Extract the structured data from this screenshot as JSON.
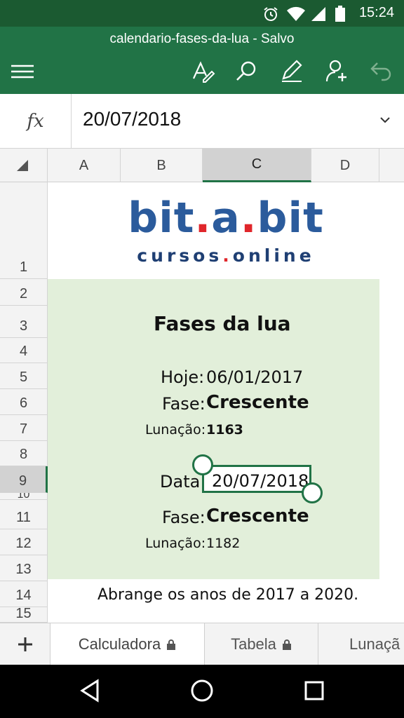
{
  "status_bar": {
    "time": "15:24"
  },
  "app": {
    "doc_title": "calendario-fases-da-lua - Salvo"
  },
  "formula_bar": {
    "fx_label": "fx",
    "value": "20/07/2018"
  },
  "columns": [
    "A",
    "B",
    "C",
    "D"
  ],
  "selected_column": "C",
  "rows": [
    "1",
    "2",
    "3",
    "4",
    "5",
    "6",
    "7",
    "8",
    "9",
    "10",
    "11",
    "12",
    "13",
    "14",
    "15"
  ],
  "selected_row": "9",
  "logo": {
    "line1": "bit.a.bit",
    "line2": "cursos.online"
  },
  "sheet": {
    "heading": "Fases da lua",
    "today_label": "Hoje:",
    "today_value": "06/01/2017",
    "phase_label": "Fase:",
    "phase_value": "Crescente",
    "lunation_label": "Lunação:",
    "lunation_value": "1163",
    "date_label": "Data:",
    "date_value": "20/07/2018",
    "phase2_label": "Fase:",
    "phase2_value": "Crescente",
    "lunation2_label": "Lunação:",
    "lunation2_value": "1182",
    "footnote": "Abrange os anos de 2017 a 2020."
  },
  "tabs": [
    {
      "label": "Calculadora",
      "locked": true,
      "active": true
    },
    {
      "label": "Tabela",
      "locked": true,
      "active": false
    },
    {
      "label": "Lunaçã",
      "locked": false,
      "active": false
    }
  ],
  "colors": {
    "brand_green": "#217346",
    "status_green": "#1b5a31",
    "fill_green": "#e2efda",
    "logo_blue": "#2b5b9c",
    "logo_red": "#e0262b"
  }
}
